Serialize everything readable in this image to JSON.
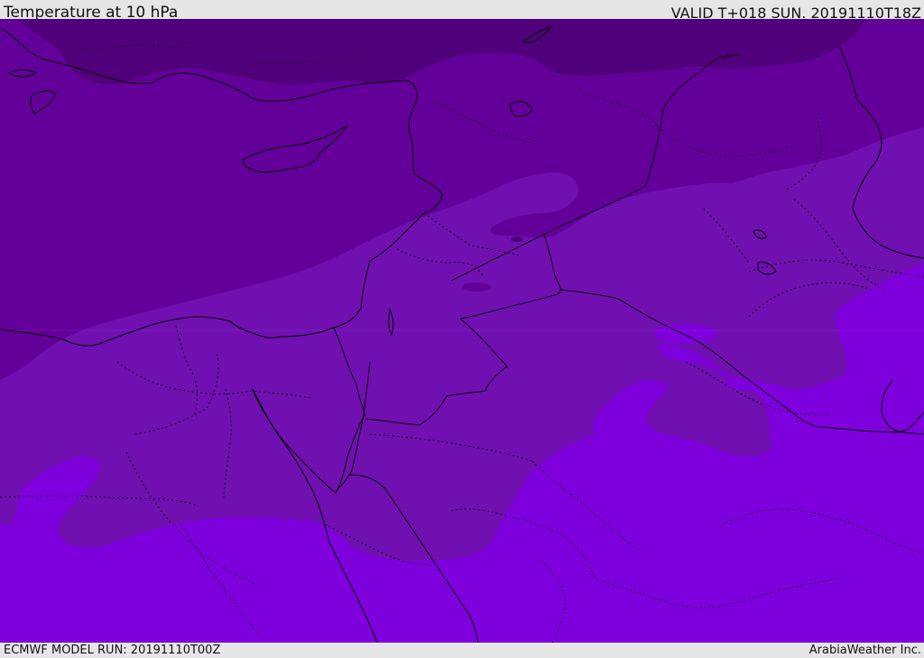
{
  "header": {
    "title": "Temperature at 10 hPa",
    "valid_time": "VALID T+018 SUN. 20191110T18Z"
  },
  "footer": {
    "model_run": "ECMWF MODEL RUN: 20191110T00Z",
    "credit": "ArabiaWeather Inc."
  },
  "colors": {
    "darkest_band": "#50007a",
    "dark_band": "#63009a",
    "mid_band": "#7010b0",
    "light_band": "#7e00dc",
    "coastline": "#000000",
    "border_dotted": "#1a0030"
  }
}
